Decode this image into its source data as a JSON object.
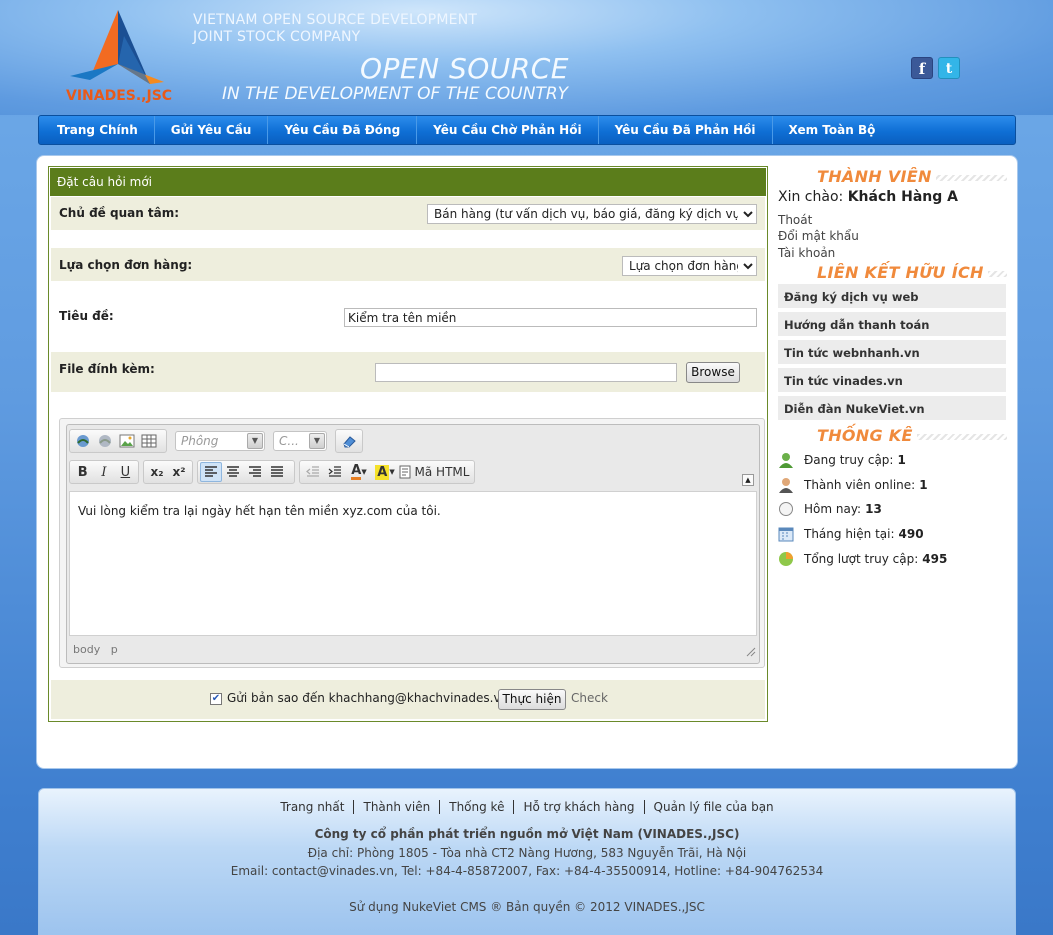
{
  "header": {
    "company_line1": "VIETNAM OPEN SOURCE DEVELOPMENT",
    "company_line2": "JOINT STOCK COMPANY",
    "logo_text": "VINADES.,JSC",
    "slogan_main": "OPEN SOURCE",
    "slogan_sub": "IN THE DEVELOPMENT OF THE COUNTRY",
    "social": [
      {
        "name": "facebook-icon",
        "glyph": "f"
      },
      {
        "name": "twitter-icon",
        "glyph": "t"
      }
    ]
  },
  "nav": {
    "items": [
      "Trang Chính",
      "Gửi Yêu Cầu",
      "Yêu Cầu Đã Đóng",
      "Yêu Cầu Chờ Phản Hồi",
      "Yêu Cầu Đã Phản Hồi",
      "Xem Toàn Bộ"
    ]
  },
  "form": {
    "title": "Đặt câu hỏi mới",
    "topic_label": "Chủ đề quan tâm:",
    "topic_value": "Bán hàng (tư vấn dịch vụ, báo giá, đăng ký dịch vụ...)",
    "order_label": "Lựa chọn đơn hàng:",
    "order_value": "Lựa chọn đơn hàng",
    "subject_label": "Tiêu đề:",
    "subject_value": "Kiểm tra tên miền",
    "attach_label": "File đính kèm:",
    "attach_value": "",
    "browse_label": "Browse",
    "copy_checked": true,
    "copy_label": "Gửi bản sao đến khachhang@khachvinades.vn",
    "submit_label": "Thực hiện",
    "check_label": "Check"
  },
  "editor": {
    "font_placeholder": "Phông",
    "size_placeholder": "C...",
    "html_label": "Mã HTML",
    "content": "Vui lòng kiểm tra lại ngày hết hạn tên miền xyz.com của tôi.",
    "path_body": "body",
    "path_p": "p",
    "toolbar_row1_icons": [
      "link-icon",
      "unlink-icon",
      "image-icon",
      "table-icon"
    ],
    "toolbar_row2": [
      "B",
      "I",
      "U",
      "x₂",
      "x²"
    ]
  },
  "sidebar": {
    "member_title": "THÀNH VIÊN",
    "greeting": "Xin chào:",
    "username": "Khách Hàng A",
    "member_links": [
      "Thoát",
      "Đổi mật khẩu",
      "Tài khoản"
    ],
    "links_title": "LIÊN KẾT HỮU ÍCH",
    "links": [
      "Đăng ký dịch vụ web",
      "Hướng dẫn thanh toán",
      "Tin tức webnhanh.vn",
      "Tin tức vinades.vn",
      "Diễn đàn NukeViet.vn"
    ],
    "stats_title": "THỐNG KÊ",
    "stats": [
      {
        "label": "Đang truy cập:",
        "value": "1",
        "icon": "user-online-icon"
      },
      {
        "label": "Thành viên online:",
        "value": "1",
        "icon": "member-icon"
      },
      {
        "label": "Hôm nay:",
        "value": "13",
        "icon": "clock-icon"
      },
      {
        "label": "Tháng hiện tại:",
        "value": "490",
        "icon": "calendar-icon"
      },
      {
        "label": "Tổng lượt truy cập:",
        "value": "495",
        "icon": "globe-icon"
      }
    ]
  },
  "footer": {
    "links": [
      "Trang nhất",
      "Thành viên",
      "Thống kê",
      "Hỗ trợ khách hàng",
      "Quản lý file của bạn"
    ],
    "company": "Công ty cổ phần phát triển nguồn mở Việt Nam (VINADES.,JSC)",
    "address": "Địa chỉ: Phòng 1805 - Tòa nhà CT2 Nàng Hương, 583 Nguyễn Trãi, Hà Nội",
    "contact": "Email: contact@vinades.vn, Tel: +84-4-85872007, Fax: +84-4-35500914, Hotline: +84-904762534",
    "copyright": "Sử dụng NukeViet CMS ® Bản quyền © 2012 VINADES.,JSC"
  }
}
